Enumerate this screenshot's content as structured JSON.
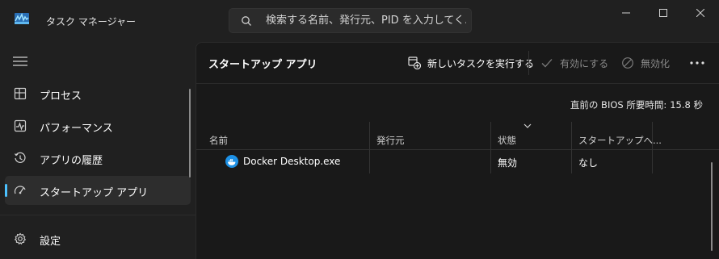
{
  "window": {
    "title": "タスク マネージャー",
    "app_icon": "task-manager-icon",
    "controls": [
      "minimize-icon",
      "maximize-icon",
      "close-icon"
    ]
  },
  "search": {
    "placeholder": "検索する名前、発行元、PID を入力してく..."
  },
  "sidebar": {
    "menu_icon": "hamburger-icon",
    "items": [
      {
        "label": "プロセス",
        "icon": "processes-icon",
        "active": false
      },
      {
        "label": "パフォーマンス",
        "icon": "performance-icon",
        "active": false
      },
      {
        "label": "アプリの履歴",
        "icon": "history-icon",
        "active": false
      },
      {
        "label": "スタートアップ アプリ",
        "icon": "startup-icon",
        "active": true
      }
    ],
    "footer": {
      "label": "設定",
      "icon": "settings-icon"
    }
  },
  "main": {
    "title": "スタートアップ アプリ",
    "toolbar": {
      "new_task": "新しいタスクを実行する",
      "enable": "有効にする",
      "disable": "無効化",
      "more_icon": "more-icon"
    },
    "bios": {
      "label": "直前の BIOS 所要時間:",
      "value": "15.8 秒"
    },
    "table": {
      "columns": [
        "名前",
        "発行元",
        "状態",
        "スタートアップへ..."
      ],
      "rows": [
        {
          "name": "Docker Desktop.exe",
          "publisher": "",
          "status": "無効",
          "impact": "なし",
          "icon": "docker-icon"
        }
      ]
    }
  },
  "colors": {
    "background": "#202020",
    "content": "#191919",
    "accent": "#4cc2ff",
    "selected": "#2d2d2d",
    "disabled_text": "#8a8a8a"
  }
}
